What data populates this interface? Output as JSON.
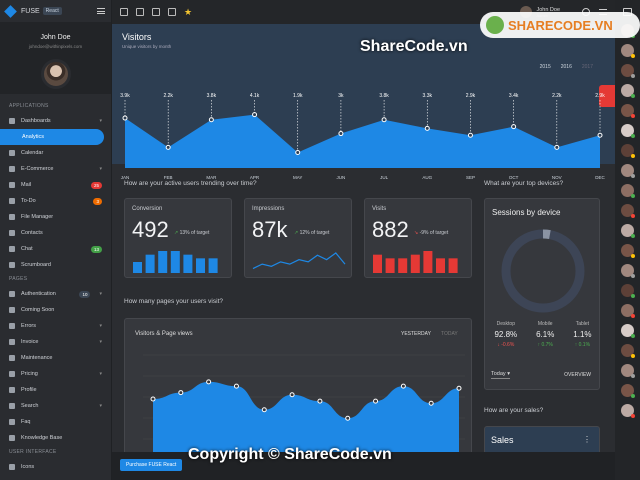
{
  "app": {
    "name": "FUSE",
    "badge": "React"
  },
  "user": {
    "name": "John Doe",
    "email": "johndoe@withinpixels.com"
  },
  "sidebar": {
    "sections": [
      "APPLICATIONS",
      "PAGES",
      "USER INTERFACE"
    ],
    "items": [
      {
        "label": "Dashboards"
      },
      {
        "label": "Analytics"
      },
      {
        "label": "Calendar"
      },
      {
        "label": "E-Commerce"
      },
      {
        "label": "Mail",
        "badge": "25",
        "badge_color": "#e53935"
      },
      {
        "label": "To-Do",
        "badge": "3",
        "badge_color": "#ef6c00"
      },
      {
        "label": "File Manager"
      },
      {
        "label": "Contacts"
      },
      {
        "label": "Chat",
        "badge": "13",
        "badge_color": "#43a047"
      },
      {
        "label": "Scrumboard"
      },
      {
        "label": "Authentication",
        "badge": "10",
        "badge_color": "#3b4654"
      },
      {
        "label": "Coming Soon"
      },
      {
        "label": "Errors"
      },
      {
        "label": "Invoice"
      },
      {
        "label": "Maintenance"
      },
      {
        "label": "Pricing"
      },
      {
        "label": "Profile"
      },
      {
        "label": "Search"
      },
      {
        "label": "Faq"
      },
      {
        "label": "Knowledge Base"
      },
      {
        "label": "Icons"
      }
    ]
  },
  "topbar": {
    "user_name": "John Doe",
    "user_role": "Admin"
  },
  "visitors": {
    "title": "Visitors",
    "subtitle": "Unique visitors by month",
    "years": [
      "2015",
      "2016",
      "2017"
    ],
    "chart_data": {
      "type": "area",
      "categories": [
        "JAN",
        "FEB",
        "MAR",
        "APR",
        "MAY",
        "JUN",
        "JUL",
        "AUG",
        "SEP",
        "OCT",
        "NOV",
        "DEC"
      ],
      "values": [
        3.9,
        2.2,
        3.8,
        4.1,
        1.9,
        3.0,
        3.8,
        3.3,
        2.9,
        3.4,
        2.2,
        2.9
      ],
      "labels": [
        "3.9k",
        "2.2k",
        "3.8k",
        "4.1k",
        "1.9k",
        "3k",
        "3.8k",
        "3.3k",
        "2.9k",
        "3.4k",
        "2.2k",
        "2.9k"
      ],
      "ylim": [
        1.0,
        4.6
      ]
    }
  },
  "questions": {
    "trending": "How are your active users trending over time?",
    "pages": "How many pages your users visit?",
    "devices": "What are your top devices?",
    "sales": "How are your sales?"
  },
  "cards": [
    {
      "label": "Conversion",
      "value": "492",
      "pct": "13% of target",
      "trend": "up",
      "color": "#1e88e5",
      "bars": [
        3,
        5,
        6,
        6,
        5,
        4,
        4
      ]
    },
    {
      "label": "Impressions",
      "value": "87k",
      "pct": "12% of target",
      "trend": "up",
      "color": "#1e88e5",
      "line": [
        2,
        4,
        3,
        5,
        4,
        6,
        5,
        8,
        6,
        9,
        4
      ]
    },
    {
      "label": "Visits",
      "value": "882",
      "pct": "-9% of target",
      "trend": "down",
      "color": "#e53935",
      "bars": [
        5,
        4,
        4,
        5,
        6,
        4,
        4
      ]
    }
  ],
  "page_views": {
    "title": "Visitors & Page views",
    "tabs": [
      "YESTERDAY",
      "TODAY"
    ],
    "chart_data": {
      "type": "area",
      "values": [
        2.8,
        3.1,
        3.6,
        3.4,
        2.3,
        3.0,
        2.7,
        1.9,
        2.7,
        3.4,
        2.6,
        3.3
      ]
    }
  },
  "devices": {
    "title": "Sessions by device",
    "items": [
      {
        "name": "Desktop",
        "value": "92.8%",
        "change": "-0.6%",
        "trend": "down"
      },
      {
        "name": "Mobile",
        "value": "6.1%",
        "change": "0.7%",
        "trend": "up"
      },
      {
        "name": "Tablet",
        "value": "1.1%",
        "change": "0.1%",
        "trend": "up"
      }
    ],
    "period": "Today",
    "overview": "OVERVIEW"
  },
  "sales": {
    "title": "Sales"
  },
  "purchase": "Purchase FUSE React",
  "watermarks": {
    "top": "ShareCode.vn",
    "bottom": "Copyright © ShareCode.vn",
    "logo": "SHARECODE.VN"
  }
}
